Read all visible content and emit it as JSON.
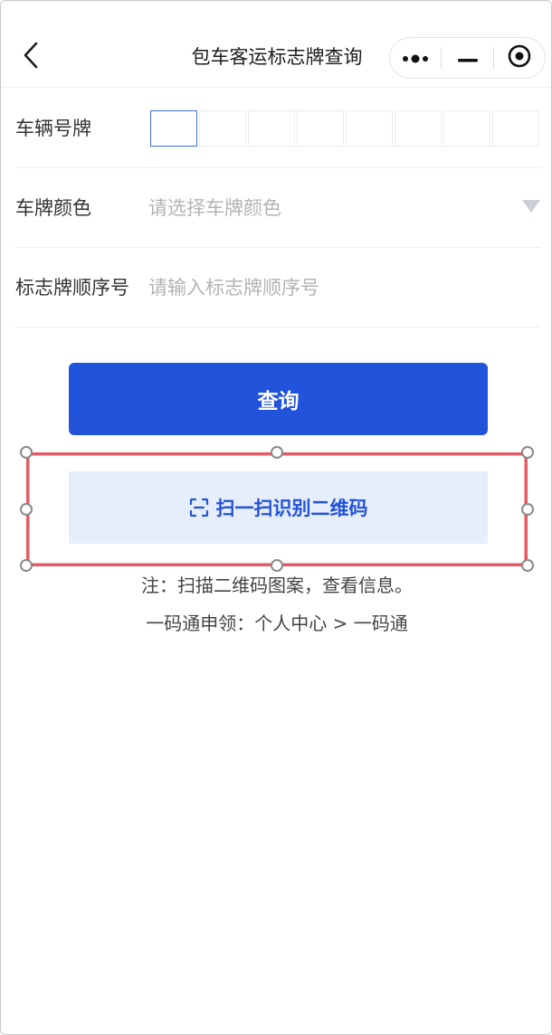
{
  "header": {
    "title": "包车客运标志牌查询",
    "back_icon": "chevron-left-icon",
    "capsule": [
      "more-dots-icon",
      "minimize-icon",
      "target-circle-icon"
    ]
  },
  "form": {
    "plate": {
      "label": "车辆号牌",
      "box_count": 8
    },
    "color": {
      "label": "车牌颜色",
      "placeholder": "请选择车牌颜色"
    },
    "serial": {
      "label": "标志牌顺序号",
      "placeholder": "请输入标志牌顺序号"
    }
  },
  "buttons": {
    "query": "查询",
    "scan": "扫一扫识别二维码",
    "scan_icon": "scan-frame-icon"
  },
  "notes": {
    "line1": "注：扫描二维码图案，查看信息。",
    "line2": "一码通申领：个人中心 > 一码通"
  },
  "colors": {
    "primary": "#2253db",
    "scan_bg": "#e6edfb",
    "selection": "#e25c66"
  }
}
